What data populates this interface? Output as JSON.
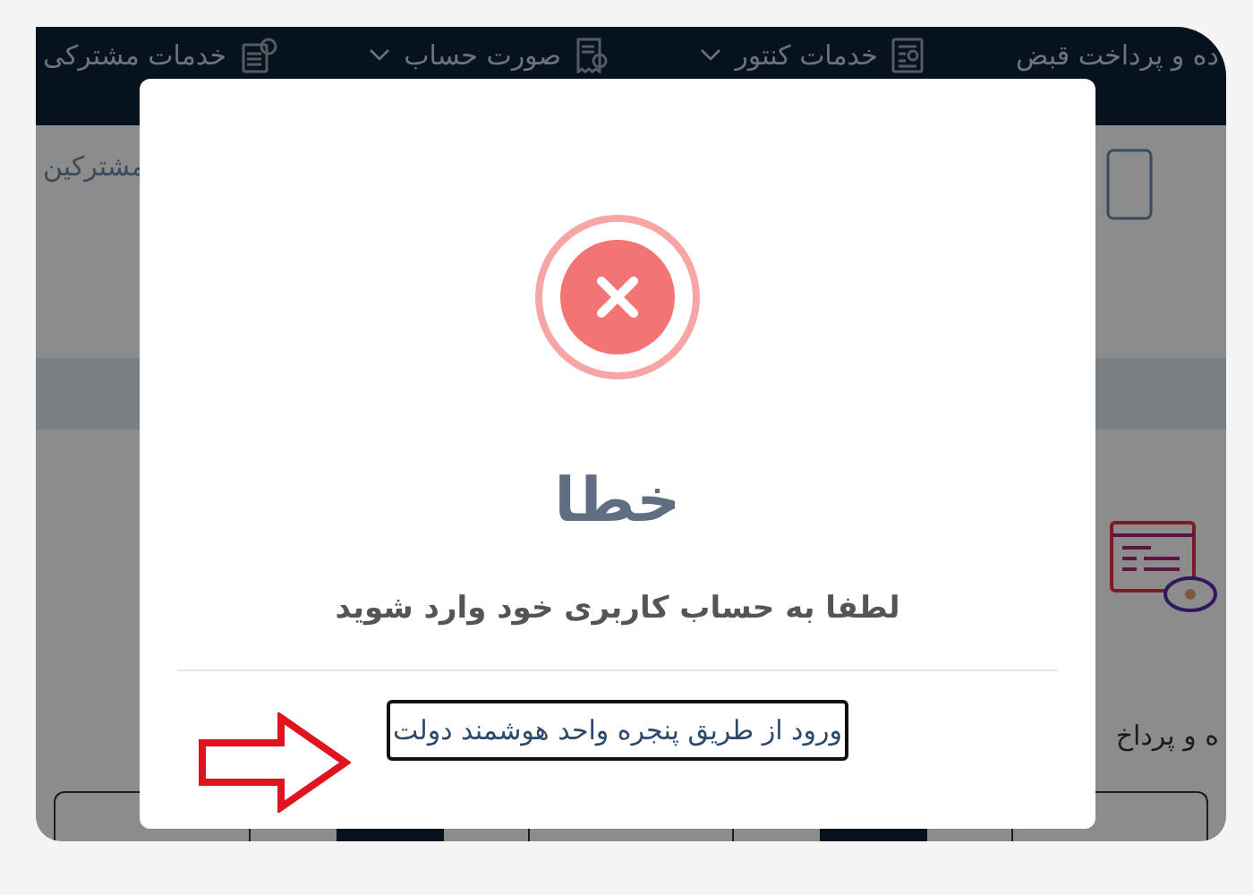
{
  "nav": {
    "items": [
      {
        "label": "ده و پرداخت قبض",
        "has_menu": false
      },
      {
        "label": "خدمات کنتور",
        "has_menu": true
      },
      {
        "label": "صورت حساب",
        "has_menu": true
      },
      {
        "label": "خدمات مشترکی",
        "has_menu": false
      }
    ]
  },
  "background": {
    "left_label": "مشترکین",
    "right_label": "ه و پرداخ"
  },
  "dialog": {
    "title": "خطا",
    "message": "لطفا به حساب کاربری خود وارد شوید",
    "link": "ورود از طریق پنجره واحد هوشمند دولت"
  }
}
